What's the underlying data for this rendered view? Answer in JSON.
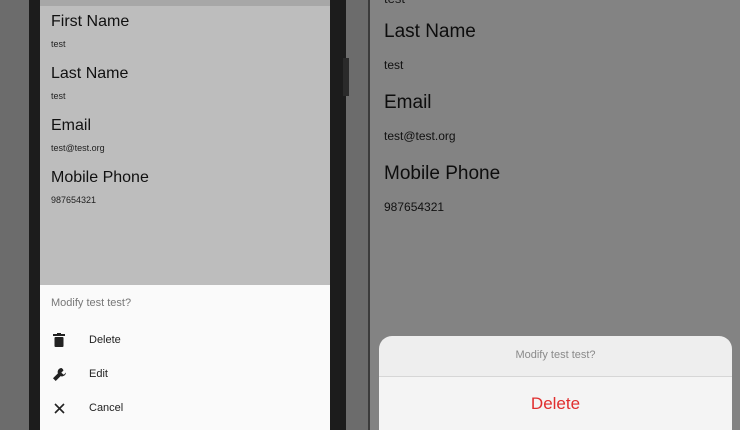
{
  "android": {
    "fields": [
      {
        "label": "First Name",
        "value": "test"
      },
      {
        "label": "Last Name",
        "value": "test"
      },
      {
        "label": "Email",
        "value": "test@test.org"
      },
      {
        "label": "Mobile Phone",
        "value": "987654321"
      }
    ],
    "sheet": {
      "title": "Modify test test?",
      "actions": [
        {
          "label": "Delete",
          "icon": "trash-icon"
        },
        {
          "label": "Edit",
          "icon": "wrench-icon"
        },
        {
          "label": "Cancel",
          "icon": "close-icon"
        }
      ]
    }
  },
  "ios": {
    "top_cut_text": "test",
    "fields": [
      {
        "label": "Last Name",
        "value": "test"
      },
      {
        "label": "Email",
        "value": "test@test.org"
      },
      {
        "label": "Mobile Phone",
        "value": "987654321"
      }
    ],
    "sheet": {
      "title": "Modify test test?",
      "delete_label": "Delete"
    }
  },
  "colors": {
    "destructive": "#e02e2e",
    "sheet_title": "#777777"
  }
}
